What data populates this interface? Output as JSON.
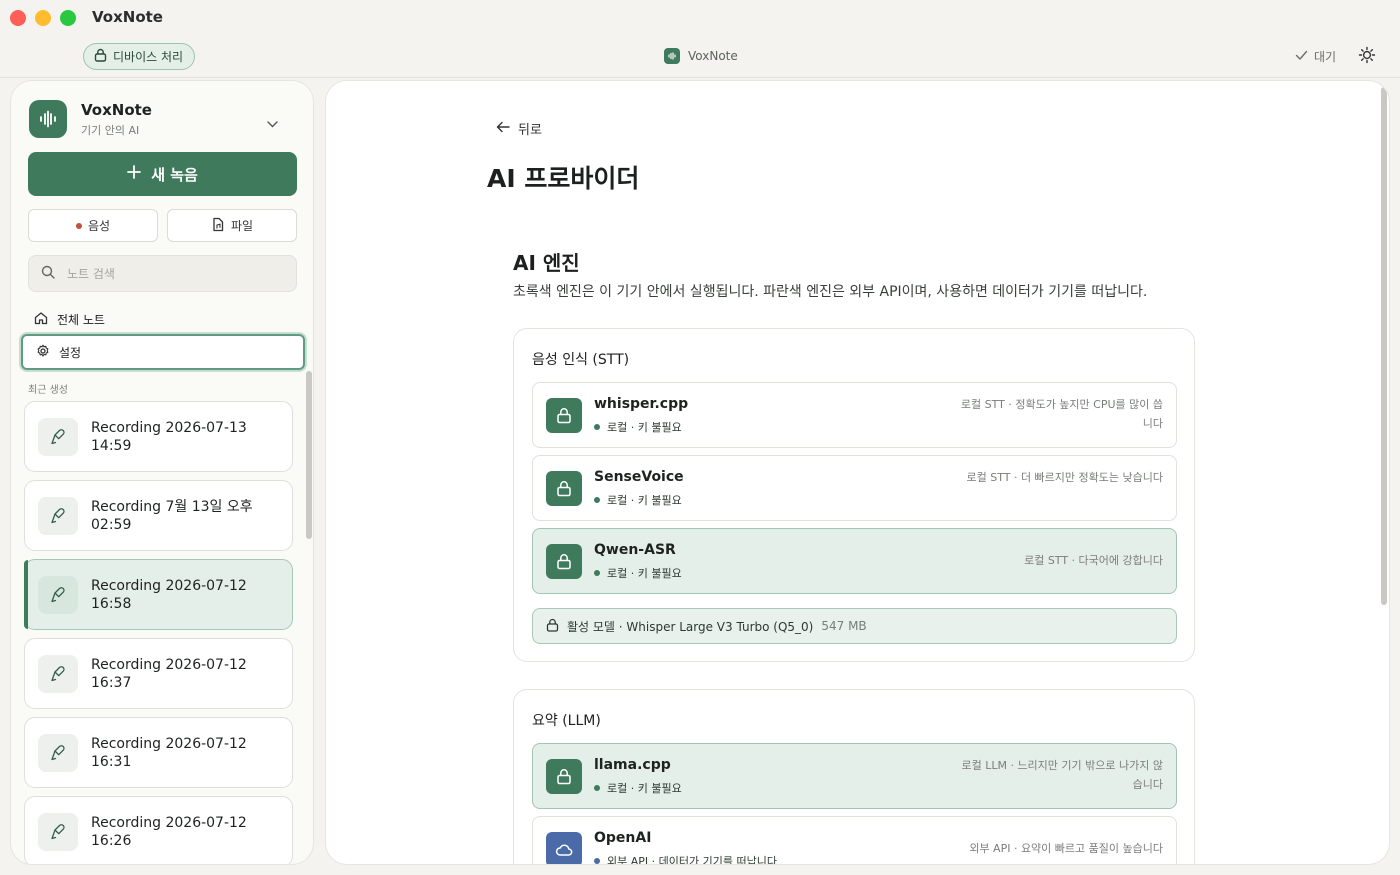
{
  "window": {
    "title": "VoxNote"
  },
  "toolbar": {
    "device_pill": "디바이스 처리",
    "center_brand": "VoxNote",
    "status": "대기"
  },
  "sidebar": {
    "workspace_name": "VoxNote",
    "workspace_sub": "기기 안의 AI",
    "new_recording": "새 녹음",
    "voice_label": "음성",
    "file_label": "파일",
    "search_placeholder": "노트 검색",
    "nav_all": "전체 노트",
    "nav_settings": "설정",
    "recent_label": "최근 생성",
    "recordings": [
      {
        "title": "Recording 2026-07-13 14:59",
        "active": false
      },
      {
        "title": "Recording 7월 13일 오후 02:59",
        "active": false
      },
      {
        "title": "Recording 2026-07-12 16:58",
        "active": true
      },
      {
        "title": "Recording 2026-07-12 16:37",
        "active": false
      },
      {
        "title": "Recording 2026-07-12 16:31",
        "active": false
      },
      {
        "title": "Recording 2026-07-12 16:26",
        "active": false
      }
    ]
  },
  "main": {
    "back_label": "뒤로",
    "page_title": "AI 프로바이더",
    "section_title": "AI 엔진",
    "section_desc": "초록색 엔진은 이 기기 안에서 실행됩니다. 파란색 엔진은 외부 API이며, 사용하면 데이터가 기기를 떠납니다.",
    "stt": {
      "title": "음성 인식 (STT)",
      "engines": [
        {
          "name": "whisper.cpp",
          "tag": "로컬 · 키 불필요",
          "note": "로컬 STT · 정확도가 높지만 CPU를 많이 씁니다",
          "active": false
        },
        {
          "name": "SenseVoice",
          "tag": "로컬 · 키 불필요",
          "note": "로컬 STT · 더 빠르지만 정확도는 낮습니다",
          "active": false
        },
        {
          "name": "Qwen-ASR",
          "tag": "로컬 · 키 불필요",
          "note": "로컬 STT · 다국어에 강합니다",
          "active": true
        }
      ],
      "active_model_label": "활성 모델 · Whisper Large V3 Turbo (Q5_0)",
      "active_model_size": "547 MB"
    },
    "llm": {
      "title": "요약 (LLM)",
      "engines": [
        {
          "name": "llama.cpp",
          "tag": "로컬 · 키 불필요",
          "note": "로컬 LLM · 느리지만 기기 밖으로 나가지 않습니다",
          "active": true
        },
        {
          "name": "OpenAI",
          "tag": "외부 API · 데이터가 기기를 떠납니다",
          "note": "외부 API · 요약이 빠르고 품질이 높습니다",
          "active": false
        }
      ]
    }
  },
  "colors": {
    "accent": "#3f7a5c",
    "external": "#4a6aa8",
    "recording_dot": "#c0533b"
  }
}
